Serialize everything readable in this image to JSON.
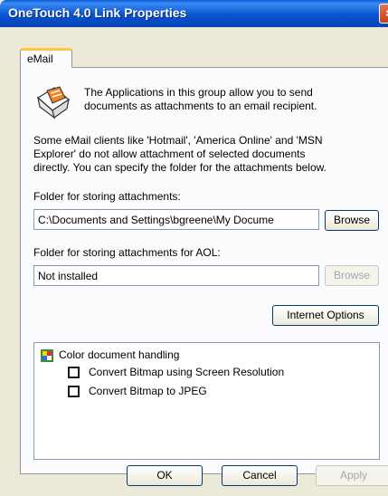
{
  "window": {
    "title": "OneTouch 4.0 Link Properties",
    "close_glyph": "×"
  },
  "tabs": [
    {
      "label": "eMail"
    }
  ],
  "intro": {
    "icon": "email-envelope-icon",
    "line1": "The Applications in this group allow you to send",
    "line2": "documents as attachments to an email recipient."
  },
  "note": {
    "line1": "Some eMail clients like 'Hotmail', 'America Online' and 'MSN",
    "line2": "Explorer' do not allow attachment of selected documents",
    "line3": "directly. You can specify the folder for the attachments below."
  },
  "attachments_folder": {
    "label": "Folder for storing attachments:",
    "value": "C:\\Documents and Settings\\bgreene\\My Docume",
    "browse_label": "Browse"
  },
  "aol_folder": {
    "label": "Folder for storing attachments for AOL:",
    "value": "Not installed",
    "browse_label": "Browse"
  },
  "internet_options_label": "Internet Options",
  "color_handling": {
    "title": "Color document handling",
    "options": [
      {
        "label": "Convert Bitmap using Screen Resolution",
        "checked": false
      },
      {
        "label": "Convert Bitmap to JPEG",
        "checked": false
      }
    ]
  },
  "footer": {
    "ok_label": "OK",
    "cancel_label": "Cancel",
    "apply_label": "Apply"
  }
}
